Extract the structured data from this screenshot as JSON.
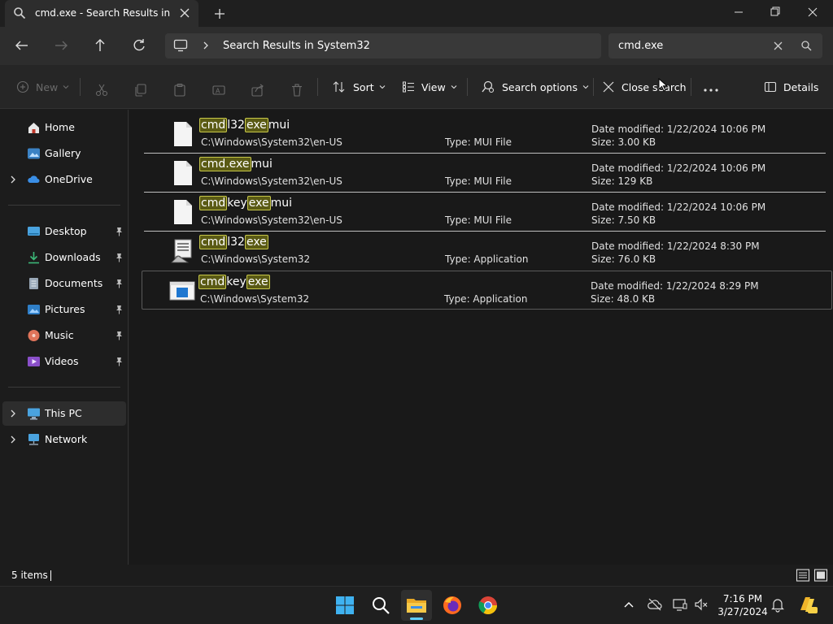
{
  "window": {
    "tab_title": "cmd.exe - Search Results in Sy",
    "controls": [
      "minimize",
      "restore",
      "close"
    ]
  },
  "nav": {
    "breadcrumb": "Search Results in System32",
    "search_query": "cmd.exe"
  },
  "commands": {
    "new": "New",
    "sort": "Sort",
    "view": "View",
    "search_options": "Search options",
    "close_search": "Close search",
    "details": "Details"
  },
  "sidebar": {
    "items": [
      {
        "label": "Home",
        "icon": "home-icon"
      },
      {
        "label": "Gallery",
        "icon": "gallery-icon"
      },
      {
        "label": "OneDrive",
        "icon": "onedrive-icon"
      },
      {
        "label": "Desktop",
        "icon": "desktop-icon"
      },
      {
        "label": "Downloads",
        "icon": "downloads-icon"
      },
      {
        "label": "Documents",
        "icon": "documents-icon"
      },
      {
        "label": "Pictures",
        "icon": "pictures-icon"
      },
      {
        "label": "Music",
        "icon": "music-icon"
      },
      {
        "label": "Videos",
        "icon": "videos-icon"
      },
      {
        "label": "This PC",
        "icon": "this-pc-icon"
      },
      {
        "label": "Network",
        "icon": "network-icon"
      }
    ]
  },
  "results": [
    {
      "name_parts": [
        {
          "t": "cmd",
          "h": true
        },
        {
          "t": "l32",
          "h": false
        },
        {
          "t": "exe",
          "h": true
        },
        {
          "t": "mui",
          "h": false
        }
      ],
      "name": "cmdl32exemui",
      "path": "C:\\Windows\\System32\\en-US",
      "type": "Type: MUI File",
      "date": "Date modified: 1/22/2024 10:06 PM",
      "size": "Size: 3.00 KB",
      "icon": "file-icon"
    },
    {
      "name_parts": [
        {
          "t": "cmd.exe",
          "h": true
        },
        {
          "t": "mui",
          "h": false
        }
      ],
      "name": "cmd.exemui",
      "path": "C:\\Windows\\System32\\en-US",
      "type": "Type: MUI File",
      "date": "Date modified: 1/22/2024 10:06 PM",
      "size": "Size: 129 KB",
      "icon": "file-icon"
    },
    {
      "name_parts": [
        {
          "t": "cmd",
          "h": true
        },
        {
          "t": "key",
          "h": false
        },
        {
          "t": "exe",
          "h": true
        },
        {
          "t": "mui",
          "h": false
        }
      ],
      "name": "cmdkeyexemui",
      "path": "C:\\Windows\\System32\\en-US",
      "type": "Type: MUI File",
      "date": "Date modified: 1/22/2024 10:06 PM",
      "size": "Size: 7.50 KB",
      "icon": "file-icon"
    },
    {
      "name_parts": [
        {
          "t": "cmd",
          "h": true
        },
        {
          "t": "l32",
          "h": false
        },
        {
          "t": "exe",
          "h": true
        }
      ],
      "name": "cmdl32exe",
      "path": "C:\\Windows\\System32",
      "type": "Type: Application",
      "date": "Date modified: 1/22/2024 8:30 PM",
      "size": "Size: 76.0 KB",
      "icon": "application-icon"
    },
    {
      "name_parts": [
        {
          "t": "cmd",
          "h": true
        },
        {
          "t": "key",
          "h": false
        },
        {
          "t": "exe",
          "h": true
        }
      ],
      "name": "cmdkeyexe",
      "path": "C:\\Windows\\System32",
      "type": "Type: Application",
      "date": "Date modified: 1/22/2024 8:29 PM",
      "size": "Size: 48.0 KB",
      "icon": "window-app-icon"
    }
  ],
  "status": {
    "count": "5 items"
  },
  "taskbar": {
    "time": "7:16 PM",
    "date": "3/27/2024",
    "accent": "#60cdff"
  },
  "colors": {
    "highlight_bg": "#5a5a14",
    "highlight_border": "#c8c84a",
    "onedrive": "#3a8ee6"
  }
}
